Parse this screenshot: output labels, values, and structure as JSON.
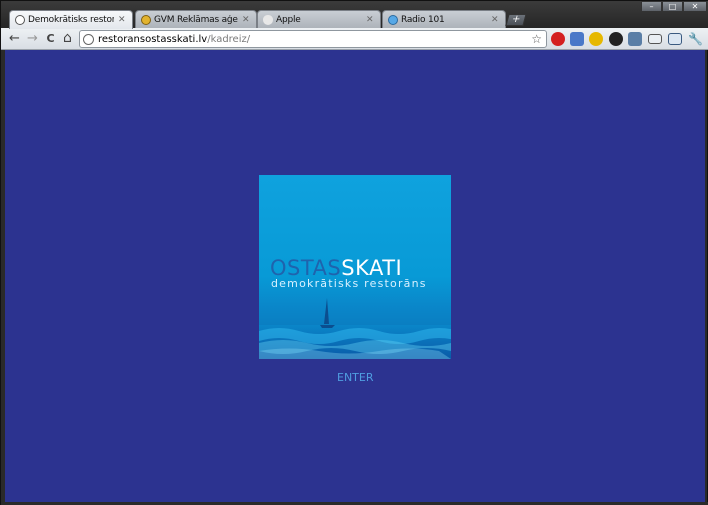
{
  "tabs": [
    {
      "title": "Demokrātisks restorāns Ostas",
      "favicon": "globe-icon",
      "active": true
    },
    {
      "title": "GVM Reklāmas aģentūra GVM",
      "favicon": "gvm-favicon",
      "active": false
    },
    {
      "title": "Apple",
      "favicon": "apple-icon",
      "active": false
    },
    {
      "title": "Radio 101",
      "favicon": "radio-icon",
      "active": false
    }
  ],
  "tab_close_glyph": "✕",
  "new_tab_glyph": "+",
  "window_controls": {
    "minimize": "–",
    "maximize": "□",
    "close": "✕"
  },
  "toolbar": {
    "back_glyph": "←",
    "forward_glyph": "→",
    "reload_glyph": "C",
    "home_glyph": "⌂",
    "url_host": "restoransostasskati.lv",
    "url_path": "/kadreiz/",
    "star_glyph": "☆"
  },
  "extensions": [
    "ublock-icon",
    "translate-icon",
    "smiley-icon",
    "record-icon",
    "screenshot-icon",
    "window-icon",
    "window2-icon",
    "wrench-icon"
  ],
  "colors": {
    "page_background": "#2c3390",
    "logo_part1": "#1f63ad",
    "logo_part2": "#ffffff",
    "enter_link": "#4f9de0"
  },
  "page": {
    "logo_text_part1": "OSTAS",
    "logo_text_part2": "SKATI",
    "logo_tagline": "demokrātisks restorāns",
    "enter_link": "ENTER"
  }
}
